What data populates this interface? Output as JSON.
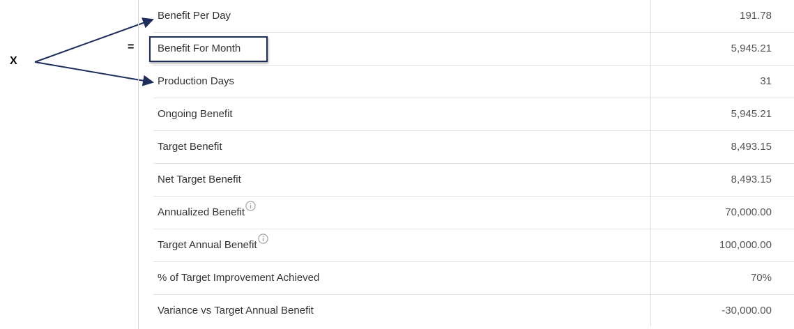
{
  "annotations": {
    "multiply_label": "X",
    "equals_label": "=",
    "arrow_color": "#1f2d5c",
    "highlight_color": "#1f2d5c"
  },
  "rows": [
    {
      "label": "Benefit Per Day",
      "value": "191.78",
      "info": false
    },
    {
      "label": "Benefit For Month",
      "value": "5,945.21",
      "info": false
    },
    {
      "label": "Production Days",
      "value": "31",
      "info": false
    },
    {
      "label": "Ongoing Benefit",
      "value": "5,945.21",
      "info": false
    },
    {
      "label": "Target Benefit",
      "value": "8,493.15",
      "info": false
    },
    {
      "label": "Net Target Benefit",
      "value": "8,493.15",
      "info": false
    },
    {
      "label": "Annualized Benefit",
      "value": "70,000.00",
      "info": true,
      "info_icon": "info-icon"
    },
    {
      "label": "Target Annual Benefit",
      "value": "100,000.00",
      "info": true,
      "info_icon": "info-icon"
    },
    {
      "label": "% of Target Improvement Achieved",
      "value": "70%",
      "info": false
    },
    {
      "label": "Variance vs Target Annual Benefit",
      "value": "-30,000.00",
      "info": false
    }
  ]
}
